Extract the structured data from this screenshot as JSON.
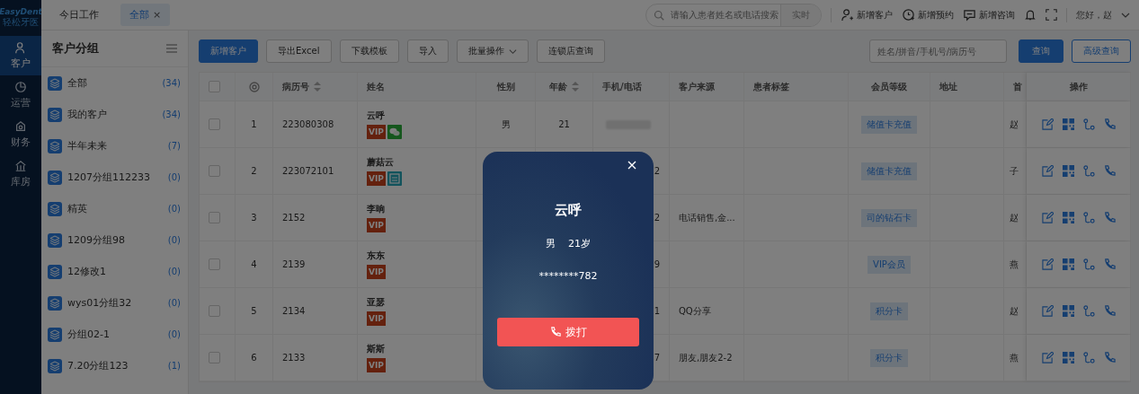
{
  "logo": {
    "name": "EasyDent",
    "subtitle": "轻松牙医"
  },
  "nav": [
    {
      "kind": "person",
      "label": "客户",
      "selected": true
    },
    {
      "kind": "chart",
      "label": "运营",
      "selected": false
    },
    {
      "kind": "money",
      "label": "财务",
      "selected": false
    },
    {
      "kind": "store",
      "label": "库房",
      "selected": false
    }
  ],
  "tabs": [
    {
      "label": "今日工作",
      "selected": false
    },
    {
      "label": "全部",
      "selected": true,
      "close": "×"
    }
  ],
  "header": {
    "search_placeholder": "请输入患者姓名或电话搜索",
    "search_button": "实时",
    "actions": [
      {
        "kind": "add-user",
        "label": "新增客户"
      },
      {
        "kind": "add-clock",
        "label": "新增预约"
      },
      {
        "kind": "chat",
        "label": "新增咨询"
      }
    ],
    "greeting": "您好，赵"
  },
  "sidebar": {
    "title": "客户分组",
    "groups": [
      {
        "label": "全部",
        "count": "(34)"
      },
      {
        "label": "我的客户",
        "count": "(34)"
      },
      {
        "label": "半年未来",
        "count": "(7)"
      },
      {
        "label": "1207分组112233",
        "count": "(0)"
      },
      {
        "label": "精英",
        "count": "(0)"
      },
      {
        "label": "1209分组98",
        "count": "(0)"
      },
      {
        "label": "12修改1",
        "count": "(0)"
      },
      {
        "label": "wys01分组32",
        "count": "(0)"
      },
      {
        "label": "分组02-1",
        "count": "(0)"
      },
      {
        "label": "7.20分组123",
        "count": "(1)"
      }
    ]
  },
  "toolbar": {
    "buttons": [
      {
        "kind": "primary",
        "label": "新增客户"
      },
      {
        "kind": "default",
        "label": "导出Excel"
      },
      {
        "kind": "default",
        "label": "下载模板"
      },
      {
        "kind": "default",
        "label": "导入"
      },
      {
        "kind": "dropdown",
        "label": "批量操作"
      },
      {
        "kind": "default",
        "label": "连锁店查询"
      }
    ],
    "search_placeholder": "姓名/拼音/手机号/病历号",
    "query": "查询",
    "advanced": "高级查询"
  },
  "table": {
    "columns": [
      {
        "kind": "checkbox",
        "checked": false
      },
      {
        "kind": "settings"
      },
      {
        "kind": "text",
        "label": "病历号",
        "sortable": true
      },
      {
        "kind": "text",
        "label": "姓名"
      },
      {
        "kind": "text",
        "label": "性别"
      },
      {
        "kind": "text",
        "label": "年龄",
        "sortable": true
      },
      {
        "kind": "text",
        "label": "手机/电话"
      },
      {
        "kind": "text",
        "label": "客户来源"
      },
      {
        "kind": "text",
        "label": "患者标签"
      },
      {
        "kind": "text",
        "label": "会员等级"
      },
      {
        "kind": "text",
        "label": "地址"
      },
      {
        "kind": "text",
        "label": "首"
      },
      {
        "kind": "text",
        "label": "操作"
      }
    ],
    "rows": [
      {
        "checked": false,
        "index": "1",
        "record": "223080308",
        "name": "云呼",
        "tags": [
          {
            "kind": "vip",
            "text": "VIP"
          },
          {
            "kind": "wechat"
          }
        ],
        "gender": "男",
        "age": "21",
        "phone_blurred": true,
        "member": "储值卡充值",
        "first_visit": "赵"
      },
      {
        "checked": false,
        "index": "2",
        "record": "223072101",
        "name": "蘑菇云",
        "tags": [
          {
            "kind": "vip",
            "text": "VIP"
          },
          {
            "kind": "card"
          }
        ],
        "phone": "2",
        "member": "储值卡充值",
        "first_visit": "子"
      },
      {
        "checked": false,
        "index": "3",
        "record": "2152",
        "name": "李晌",
        "tags": [
          {
            "kind": "vip",
            "text": "VIP"
          }
        ],
        "phone": "2",
        "source": "电话销售,金...",
        "member": "司的钻石卡",
        "first_visit": "赵"
      },
      {
        "checked": false,
        "index": "4",
        "record": "2139",
        "name": "东东",
        "tags": [
          {
            "kind": "vip",
            "text": "VIP"
          }
        ],
        "phone": "9",
        "member": "VIP会员",
        "first_visit": "燕"
      },
      {
        "checked": false,
        "index": "5",
        "record": "2134",
        "name": "亚瑟",
        "tags": [
          {
            "kind": "vip",
            "text": "VIP"
          }
        ],
        "phone": "1",
        "source": "QQ分享",
        "member": "积分卡",
        "first_visit": "赵"
      },
      {
        "checked": false,
        "index": "6",
        "record": "2133",
        "name": "斯斯",
        "tags": [
          {
            "kind": "vip",
            "text": "VIP"
          }
        ],
        "phone": "7",
        "source": "朋友,朋友2-2",
        "member": "积分卡",
        "first_visit": "燕"
      }
    ]
  },
  "modal": {
    "title": "云呼",
    "gender": "男",
    "age": "21岁",
    "phone": "********782",
    "call_button": "拨打"
  }
}
